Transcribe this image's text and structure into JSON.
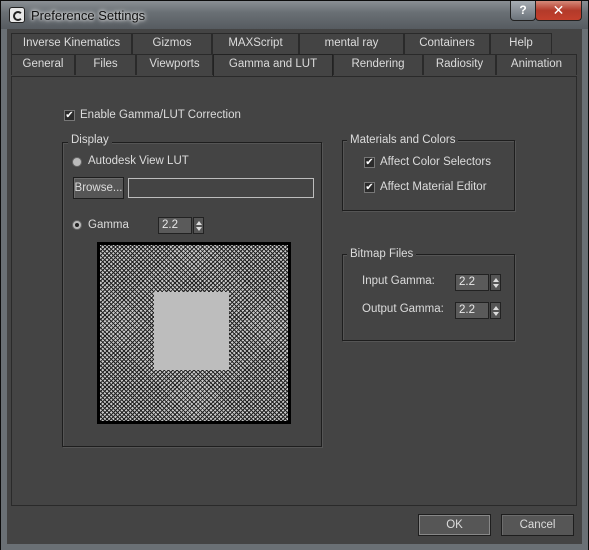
{
  "window": {
    "title": "Preference Settings",
    "help_label": "?",
    "close_label": "✕"
  },
  "tabs_row1": [
    "Inverse Kinematics",
    "Gizmos",
    "MAXScript",
    "mental ray",
    "Containers",
    "Help"
  ],
  "tabs_row2": [
    "General",
    "Files",
    "Viewports",
    "Gamma and LUT",
    "Rendering",
    "Radiosity",
    "Animation"
  ],
  "active_tab": "Gamma and LUT",
  "enable_correction": {
    "label": "Enable Gamma/LUT Correction",
    "checked": true
  },
  "display": {
    "group_label": "Display",
    "autodesk_lut_label": "Autodesk View LUT",
    "browse_label": "Browse...",
    "lut_path": "",
    "gamma_label": "Gamma",
    "gamma_value": "2.2",
    "gamma_selected": true
  },
  "materials": {
    "group_label": "Materials and Colors",
    "affect_color_selectors": {
      "label": "Affect Color Selectors",
      "checked": true
    },
    "affect_material_editor": {
      "label": "Affect Material Editor",
      "checked": true
    }
  },
  "bitmap": {
    "group_label": "Bitmap Files",
    "input_label": "Input Gamma:",
    "input_value": "2.2",
    "output_label": "Output Gamma:",
    "output_value": "2.2"
  },
  "footer": {
    "ok_label": "OK",
    "cancel_label": "Cancel"
  },
  "colors": {
    "panel": "#444444",
    "frame": "#6a7075",
    "close": "#c4402c"
  }
}
